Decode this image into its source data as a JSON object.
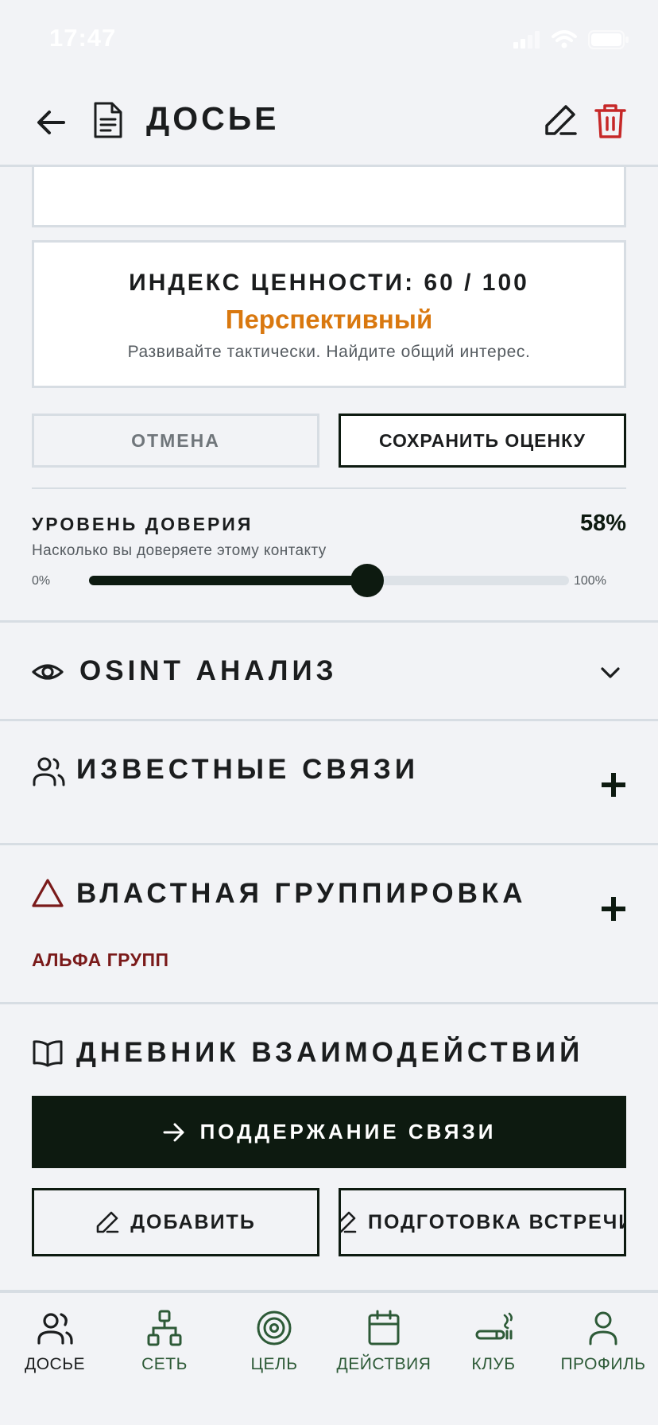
{
  "status_bar": {
    "time": "17:47"
  },
  "header": {
    "title": "ДОСЬЕ"
  },
  "value_index": {
    "title": "ИНДЕКС ЦЕННОСТИ: 60 / 100",
    "label": "Перспективный",
    "hint": "Развивайте тактически. Найдите общий интерес.",
    "label_color": "#d9780f"
  },
  "actions": {
    "cancel": "ОТМЕНА",
    "save": "СОХРАНИТЬ ОЦЕНКУ"
  },
  "trust": {
    "title": "УРОВЕНЬ ДОВЕРИЯ",
    "value_text": "58%",
    "subtitle": "Насколько вы доверяете этому контакту",
    "min_label": "0%",
    "max_label": "100%",
    "value": 58
  },
  "sections": {
    "osint": {
      "title": "OSINT АНАЛИЗ"
    },
    "connections": {
      "title": "ИЗВЕСТНЫЕ СВЯЗИ"
    },
    "power_group": {
      "title": "ВЛАСТНАЯ ГРУППИРОВКА",
      "items": [
        "АЛЬФА ГРУПП"
      ]
    },
    "diary": {
      "title": "ДНЕВНИК ВЗАИМОДЕЙСТВИЙ",
      "primary_button": "ПОДДЕРЖАНИЕ СВЯЗИ",
      "add_button": "ДОБАВИТЬ",
      "prep_button": "ПОДГОТОВКА ВСТРЕЧИ"
    }
  },
  "tabbar": {
    "items": [
      {
        "label": "ДОСЬЕ",
        "icon": "people-icon",
        "active": true
      },
      {
        "label": "СЕТЬ",
        "icon": "network-icon"
      },
      {
        "label": "ЦЕЛЬ",
        "icon": "target-icon"
      },
      {
        "label": "ДЕЙСТВИЯ",
        "icon": "calendar-icon"
      },
      {
        "label": "КЛУБ",
        "icon": "cigar-icon"
      },
      {
        "label": "ПРОФИЛЬ",
        "icon": "user-icon"
      }
    ]
  },
  "colors": {
    "primary": "#0d1a10",
    "accent_orange": "#d9780f",
    "danger": "#c62828",
    "group_red": "#7a1a1a",
    "tab_green": "#2d5a37"
  }
}
